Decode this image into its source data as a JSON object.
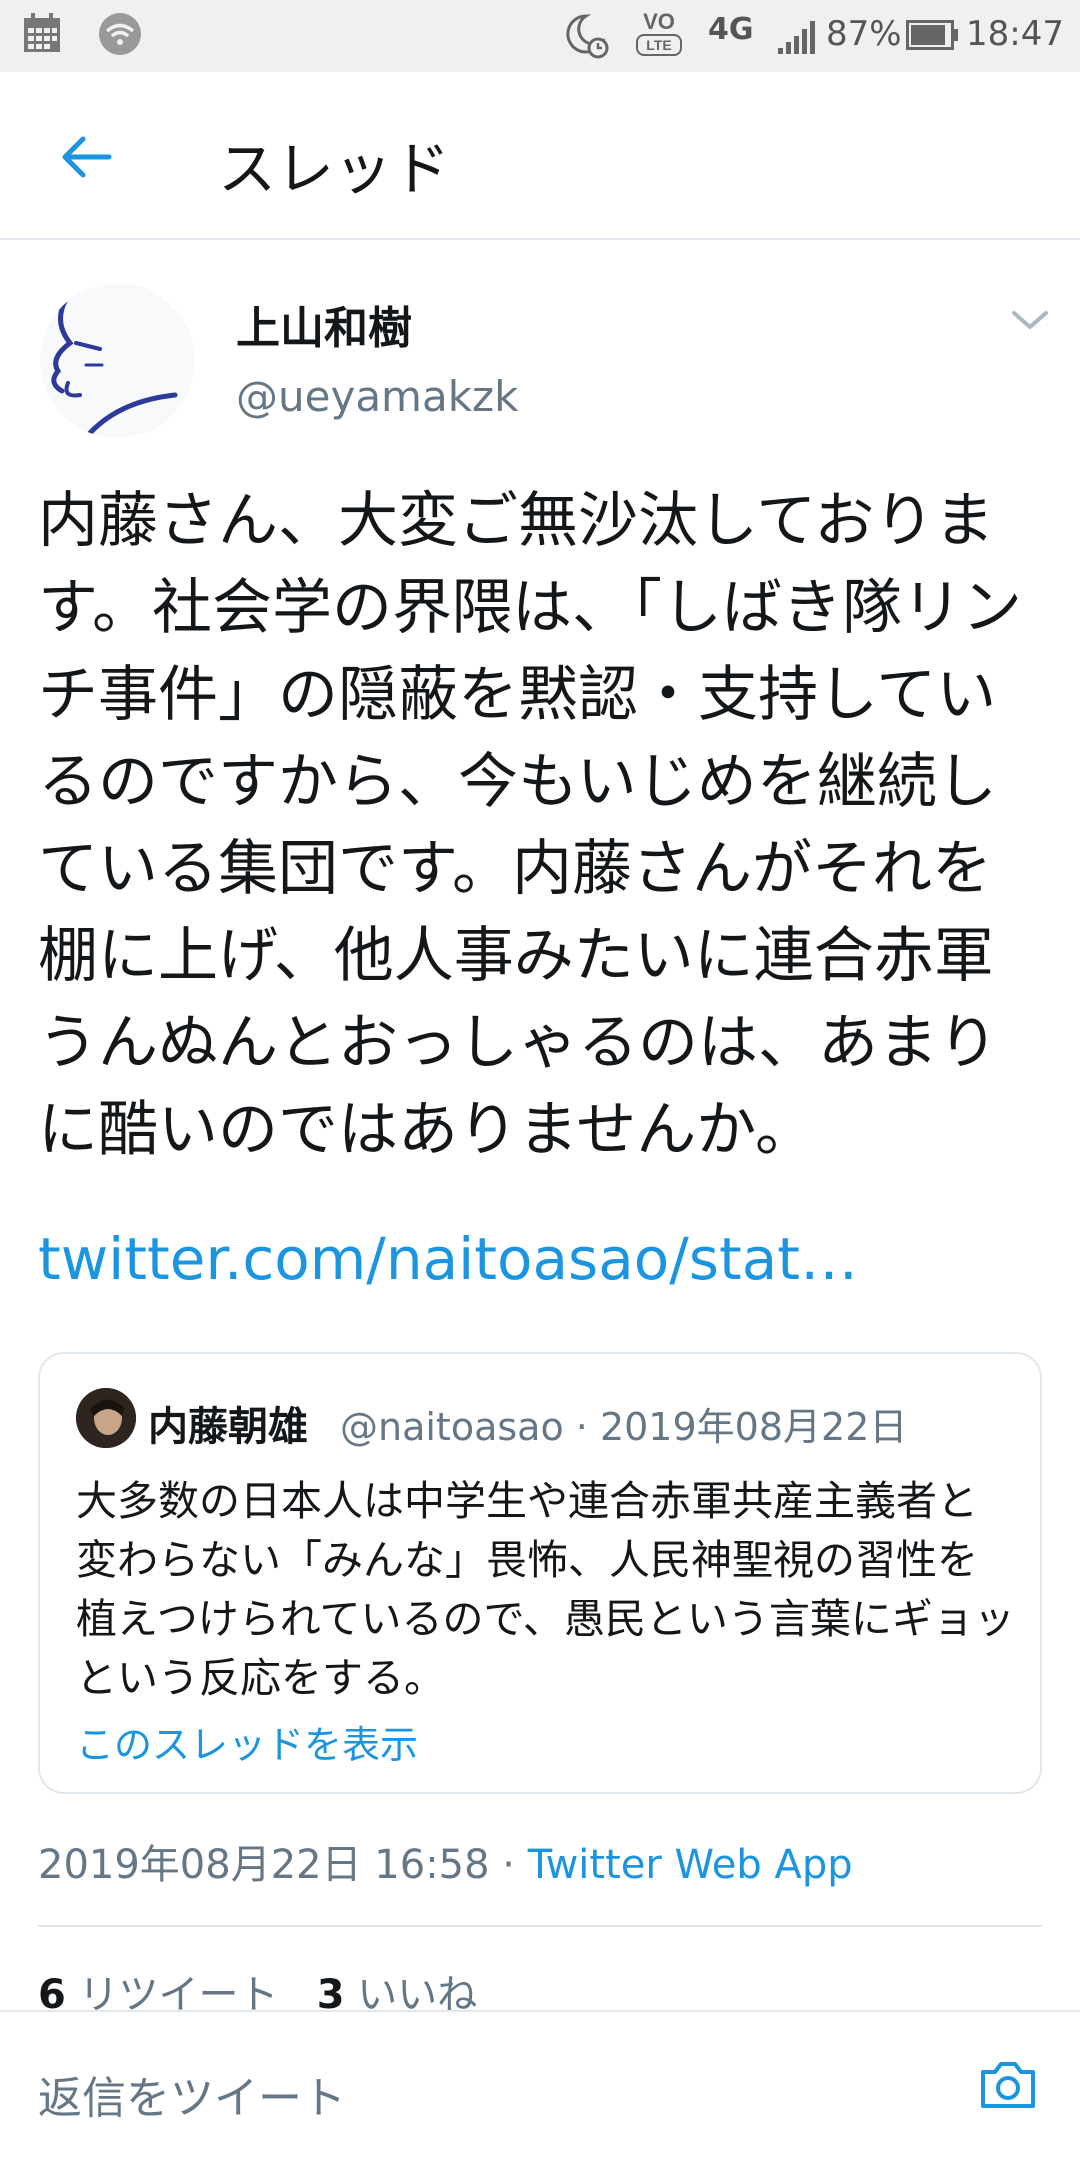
{
  "status_bar": {
    "icons": [
      "calendar-icon",
      "wifi-icon",
      "do-not-disturb-icon",
      "volte-icon",
      "4g-icon",
      "signal-icon",
      "battery-icon"
    ],
    "volte_label": "VO",
    "volte_sub": "LTE",
    "network": "4G",
    "battery": "87%",
    "time": "18:47"
  },
  "header": {
    "title": "スレッド",
    "back_icon": "arrow-left-icon"
  },
  "tweet": {
    "display_name": "上山和樹",
    "handle": "@ueyamakzk",
    "text": "内藤さん、大変ご無沙汰しております。社会学の界隈は、「しばき隊リンチ事件」の隠蔽を黙認・支持しているのですから、今もいじめを継続している集団です。内藤さんがそれを棚に上げ、他人事みたいに連合赤軍うんぬんとおっしゃるのは、あまりに酷いのではありませんか。",
    "link": "twitter.com/naitoasao/stat…",
    "timestamp": "2019年08月22日 16:58",
    "separator": " · ",
    "source": "Twitter Web App",
    "retweets_count": "6",
    "retweets_label": "リツイート",
    "likes_count": "3",
    "likes_label": "いいね"
  },
  "quoted_tweet": {
    "display_name": "内藤朝雄",
    "handle": "@naitoasao",
    "separator": " · ",
    "date": "2019年08月22日",
    "text": "大多数の日本人は中学生や連合赤軍共産主義者と変わらない「みんな」畏怖、人民神聖視の習性を植えつけられているので、愚民という言葉にギョッという反応をする。",
    "show_thread": "このスレッドを表示"
  },
  "reply_bar": {
    "placeholder": "返信をツイート",
    "camera_icon": "camera-icon"
  },
  "colors": {
    "accent": "#1b95e0",
    "text": "#14171a",
    "secondary": "#657786",
    "border": "#e1e8ed",
    "status_bar_bg": "#f0f0f0"
  }
}
